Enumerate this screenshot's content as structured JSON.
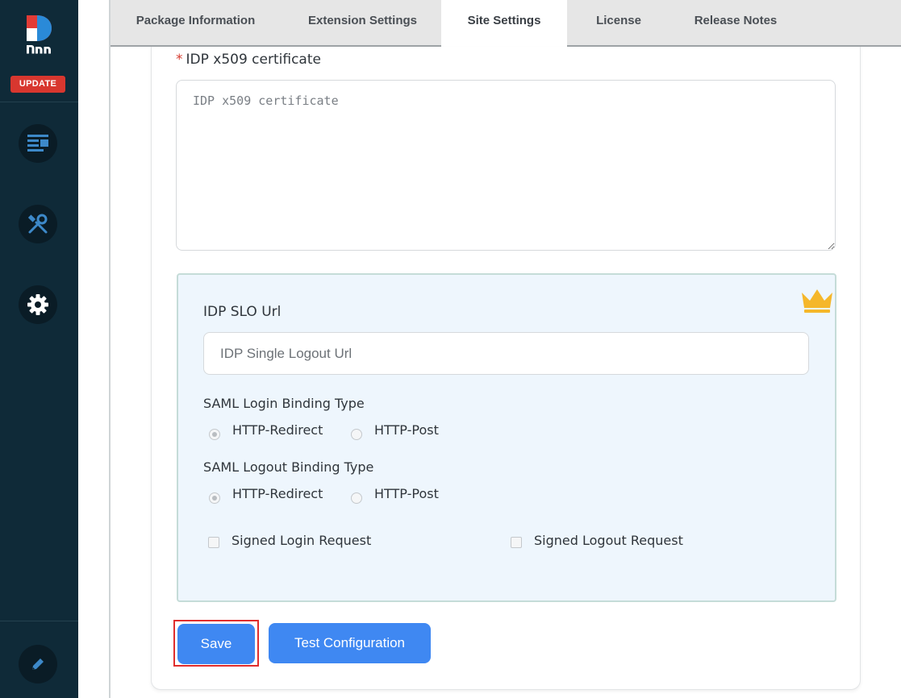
{
  "sidebar": {
    "logo_text": "DNN",
    "update_badge": "UPDATE",
    "nav_icons": [
      "content-icon",
      "tools-icon",
      "settings-icon",
      "edit-icon"
    ]
  },
  "tabs": [
    {
      "label": "Package Information",
      "active": false
    },
    {
      "label": "Extension Settings",
      "active": false
    },
    {
      "label": "Site Settings",
      "active": true
    },
    {
      "label": "License",
      "active": false
    },
    {
      "label": "Release Notes",
      "active": false
    }
  ],
  "form": {
    "cert": {
      "required_marker": "*",
      "label": "IDP x509 certificate",
      "placeholder": "IDP x509 certificate",
      "value": ""
    },
    "premium": {
      "icon": "crown-icon",
      "slo_label": "IDP SLO Url",
      "slo_placeholder": "IDP Single Logout Url",
      "slo_value": "",
      "login_binding": {
        "label": "SAML Login Binding Type",
        "options": [
          "HTTP-Redirect",
          "HTTP-Post"
        ],
        "selected": "HTTP-Redirect"
      },
      "logout_binding": {
        "label": "SAML Logout Binding Type",
        "options": [
          "HTTP-Redirect",
          "HTTP-Post"
        ],
        "selected": "HTTP-Redirect"
      },
      "signed_login": {
        "label": "Signed Login Request",
        "checked": false
      },
      "signed_logout": {
        "label": "Signed Logout Request",
        "checked": false
      }
    },
    "buttons": {
      "save": "Save",
      "test": "Test Configuration"
    }
  },
  "colors": {
    "sidebar_bg": "#0f2a38",
    "update_badge": "#d8372f",
    "primary_button": "#3f88f2",
    "highlight_outline": "#e02d2d",
    "crown": "#f5b72a",
    "premium_bg": "#eef6fd"
  }
}
